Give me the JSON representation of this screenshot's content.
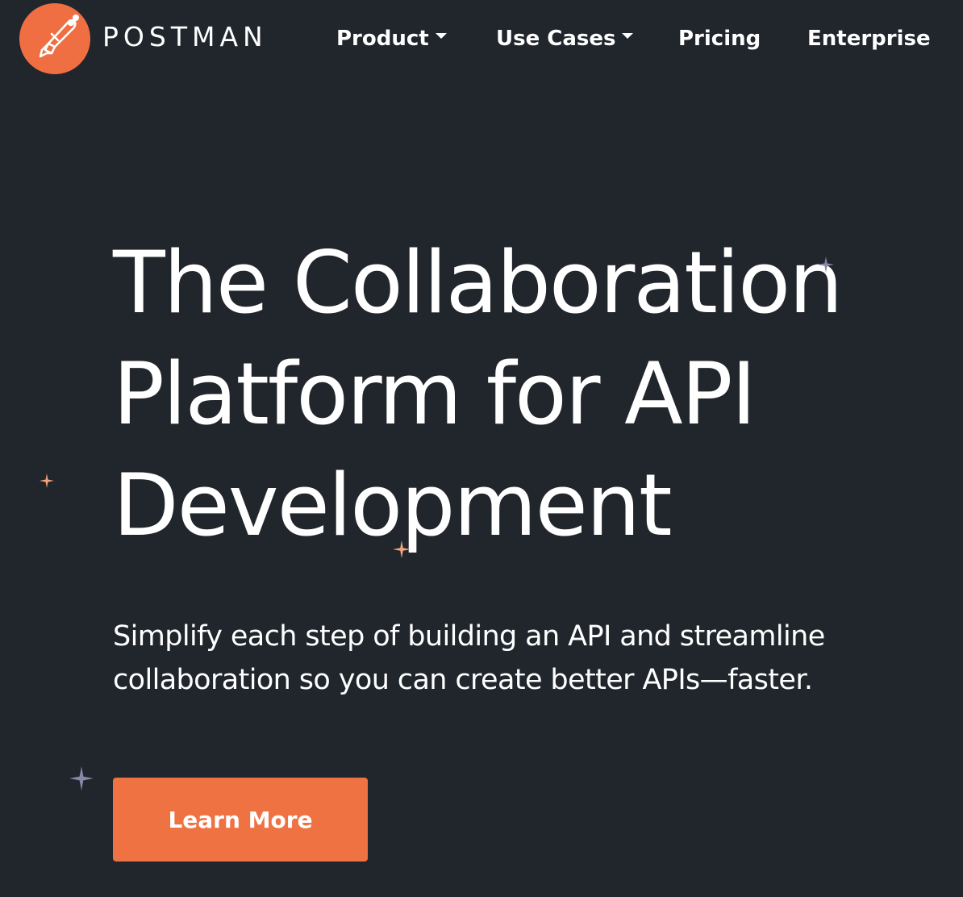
{
  "brand": {
    "name": "POSTMAN",
    "logo_icon": "postman-astronaut-icon",
    "accent_color": "#ef6f42"
  },
  "nav": {
    "items": [
      {
        "label": "Product",
        "has_dropdown": true
      },
      {
        "label": "Use Cases",
        "has_dropdown": true
      },
      {
        "label": "Pricing",
        "has_dropdown": false
      },
      {
        "label": "Enterprise",
        "has_dropdown": false
      }
    ]
  },
  "hero": {
    "title_lines": [
      "The Collaboration",
      "Platform for API",
      "Development"
    ],
    "subtitle_lines": [
      "Simplify each step of building an API and streamline",
      "collaboration so you can create better APIs—faster."
    ],
    "cta_label": "Learn More"
  },
  "colors": {
    "background": "#20262c",
    "text": "#ffffff",
    "button": "#ef7243",
    "sparkle_orange": "#f0a37d",
    "sparkle_purple": "#8a86a8"
  },
  "icons": [
    "sparkle-icon",
    "caret-down-icon"
  ]
}
